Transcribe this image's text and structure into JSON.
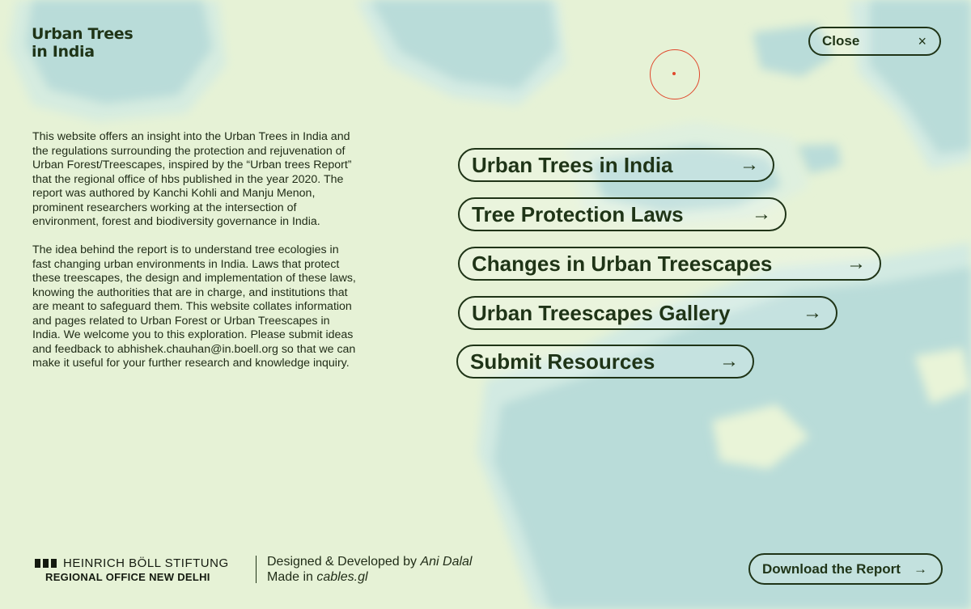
{
  "site": {
    "title_line1": "Urban Trees",
    "title_line2": "in India"
  },
  "close": {
    "label": "Close",
    "icon": "×"
  },
  "intro": {
    "paragraph1": "This website offers an insight into the Urban Trees in India and the regulations surrounding the protection and rejuvenation of Urban Forest/Treescapes, inspired by the “Urban trees Report” that the regional office of hbs published in the year 2020.  The report was authored by Kanchi Kohli and Manju Menon, prominent researchers working at the intersection of environment, forest and biodiversity governance in India.",
    "paragraph2": "The idea behind the report is to understand tree ecologies in fast changing urban environments in India. Laws that protect these treescapes, the design and implementation of these laws, knowing the authorities that are in charge, and institutions that are meant to safeguard them. This website collates information and pages related to Urban Forest or Urban Treescapes in India. We welcome you to this exploration. Please submit ideas and feedback to abhishek.chauhan@in.boell.org so that we can make it useful for your further research and knowledge inquiry."
  },
  "menu": {
    "arrow": "→",
    "items": [
      {
        "label": "Urban Trees in India"
      },
      {
        "label": "Tree Protection Laws"
      },
      {
        "label": "Changes in Urban Treescapes"
      },
      {
        "label": "Urban Treescapes Gallery"
      },
      {
        "label": "Submit Resources"
      }
    ]
  },
  "footer": {
    "org_name": "HEINRICH BÖLL STIFTUNG",
    "org_office": "REGIONAL OFFICE NEW DELHI",
    "credit_prefix": "Designed & Developed by ",
    "credit_name": "Ani Dalal",
    "made_prefix": "Made in ",
    "made_tool": "cables.gl",
    "download_label": "Download the Report",
    "download_arrow": "→"
  },
  "colors": {
    "text": "#1f3417",
    "background_light": "#e9f3d9",
    "water_blue": "#b7dbd9",
    "cursor_ring": "#e0482c"
  }
}
